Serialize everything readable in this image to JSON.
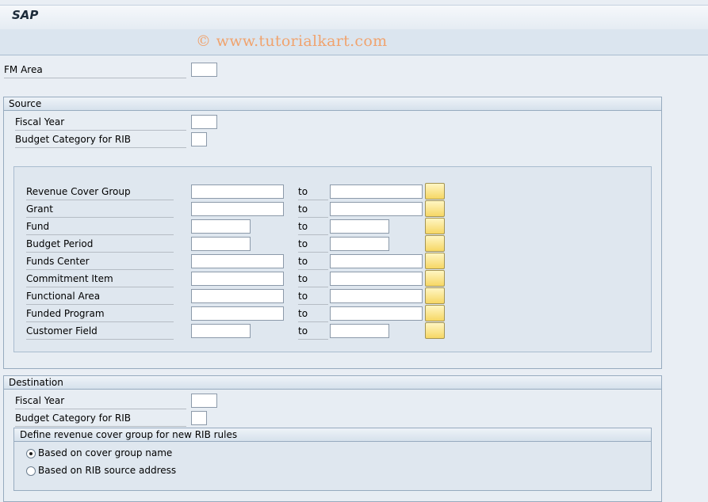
{
  "title": "SAP",
  "watermark": "© www.tutorialkart.com",
  "fm_area": {
    "label": "FM Area",
    "value": ""
  },
  "source": {
    "header": "Source",
    "fiscal_year": {
      "label": "Fiscal Year",
      "value": ""
    },
    "budget_category": {
      "label": "Budget Category for RIB",
      "value": ""
    },
    "range_to_label": "to",
    "ranges": [
      {
        "label": "Revenue Cover Group",
        "from": "",
        "to": ""
      },
      {
        "label": "Grant",
        "from": "",
        "to": ""
      },
      {
        "label": "Fund",
        "from": "",
        "to": ""
      },
      {
        "label": "Budget Period",
        "from": "",
        "to": ""
      },
      {
        "label": "Funds Center",
        "from": "",
        "to": ""
      },
      {
        "label": "Commitment Item",
        "from": "",
        "to": ""
      },
      {
        "label": "Functional Area",
        "from": "",
        "to": ""
      },
      {
        "label": "Funded Program",
        "from": "",
        "to": ""
      },
      {
        "label": "Customer Field",
        "from": "",
        "to": ""
      }
    ]
  },
  "destination": {
    "header": "Destination",
    "fiscal_year": {
      "label": "Fiscal Year",
      "value": ""
    },
    "budget_category": {
      "label": "Budget Category for RIB",
      "value": ""
    },
    "define_group": {
      "header": "Define revenue cover group for new RIB rules",
      "options": [
        {
          "label": "Based on cover group name",
          "selected": true
        },
        {
          "label": "Based on RIB source address",
          "selected": false
        }
      ]
    }
  },
  "colors": {
    "multi_select_button": "#f6d765",
    "background": "#e9eef4"
  },
  "icons": {
    "multi_select": "multiple-selection-icon"
  }
}
